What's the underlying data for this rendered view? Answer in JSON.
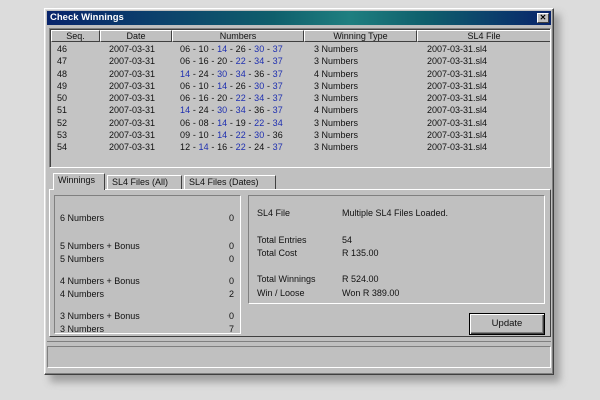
{
  "window": {
    "title": "Check Winnings",
    "close_label": "✕"
  },
  "list": {
    "headers": [
      "Seq.",
      "Date",
      "Numbers",
      "Winning Type",
      "SL4 File"
    ],
    "rows": [
      {
        "seq": "46",
        "date": "2007-03-31",
        "numbers": [
          [
            "06",
            "miss"
          ],
          [
            "10",
            "miss"
          ],
          [
            "14",
            "hit"
          ],
          [
            "26",
            "miss"
          ],
          [
            "30",
            "hit"
          ],
          [
            "37",
            "hit"
          ]
        ],
        "type": "3 Numbers",
        "file": "2007-03-31.sl4"
      },
      {
        "seq": "47",
        "date": "2007-03-31",
        "numbers": [
          [
            "06",
            "miss"
          ],
          [
            "16",
            "miss"
          ],
          [
            "20",
            "miss"
          ],
          [
            "22",
            "hit"
          ],
          [
            "34",
            "hit"
          ],
          [
            "37",
            "hit"
          ]
        ],
        "type": "3 Numbers",
        "file": "2007-03-31.sl4"
      },
      {
        "seq": "48",
        "date": "2007-03-31",
        "numbers": [
          [
            "14",
            "hit"
          ],
          [
            "24",
            "miss"
          ],
          [
            "30",
            "hit"
          ],
          [
            "34",
            "hit"
          ],
          [
            "36",
            "miss"
          ],
          [
            "37",
            "hit"
          ]
        ],
        "type": "4 Numbers",
        "file": "2007-03-31.sl4"
      },
      {
        "seq": "49",
        "date": "2007-03-31",
        "numbers": [
          [
            "06",
            "miss"
          ],
          [
            "10",
            "miss"
          ],
          [
            "14",
            "hit"
          ],
          [
            "26",
            "miss"
          ],
          [
            "30",
            "hit"
          ],
          [
            "37",
            "hit"
          ]
        ],
        "type": "3 Numbers",
        "file": "2007-03-31.sl4"
      },
      {
        "seq": "50",
        "date": "2007-03-31",
        "numbers": [
          [
            "06",
            "miss"
          ],
          [
            "16",
            "miss"
          ],
          [
            "20",
            "miss"
          ],
          [
            "22",
            "hit"
          ],
          [
            "34",
            "hit"
          ],
          [
            "37",
            "hit"
          ]
        ],
        "type": "3 Numbers",
        "file": "2007-03-31.sl4"
      },
      {
        "seq": "51",
        "date": "2007-03-31",
        "numbers": [
          [
            "14",
            "hit"
          ],
          [
            "24",
            "miss"
          ],
          [
            "30",
            "hit"
          ],
          [
            "34",
            "hit"
          ],
          [
            "36",
            "miss"
          ],
          [
            "37",
            "hit"
          ]
        ],
        "type": "4 Numbers",
        "file": "2007-03-31.sl4"
      },
      {
        "seq": "52",
        "date": "2007-03-31",
        "numbers": [
          [
            "06",
            "miss"
          ],
          [
            "08",
            "miss"
          ],
          [
            "14",
            "hit"
          ],
          [
            "19",
            "miss"
          ],
          [
            "22",
            "hit"
          ],
          [
            "34",
            "hit"
          ]
        ],
        "type": "3 Numbers",
        "file": "2007-03-31.sl4"
      },
      {
        "seq": "53",
        "date": "2007-03-31",
        "numbers": [
          [
            "09",
            "miss"
          ],
          [
            "10",
            "miss"
          ],
          [
            "14",
            "hit"
          ],
          [
            "22",
            "hit"
          ],
          [
            "30",
            "hit"
          ],
          [
            "36",
            "miss"
          ]
        ],
        "type": "3 Numbers",
        "file": "2007-03-31.sl4"
      },
      {
        "seq": "54",
        "date": "2007-03-31",
        "numbers": [
          [
            "12",
            "miss"
          ],
          [
            "14",
            "hit"
          ],
          [
            "16",
            "miss"
          ],
          [
            "22",
            "hit"
          ],
          [
            "24",
            "miss"
          ],
          [
            "37",
            "hit"
          ]
        ],
        "type": "3 Numbers",
        "file": "2007-03-31.sl4"
      }
    ]
  },
  "tabs": [
    "Winnings",
    "SL4 Files (All)",
    "SL4 Files (Dates)"
  ],
  "winnings": [
    {
      "label": "6 Numbers",
      "value": "0"
    },
    {
      "label": "5 Numbers + Bonus",
      "value": "0"
    },
    {
      "label": "5 Numbers",
      "value": "0"
    },
    {
      "label": "4 Numbers + Bonus",
      "value": "0"
    },
    {
      "label": "4 Numbers",
      "value": "2"
    },
    {
      "label": "3 Numbers + Bonus",
      "value": "0"
    },
    {
      "label": "3 Numbers",
      "value": "7"
    }
  ],
  "summary": {
    "sl4_file_label": "SL4 File",
    "sl4_file_value": "Multiple SL4 Files Loaded.",
    "total_entries_label": "Total Entries",
    "total_entries_value": "54",
    "total_cost_label": "Total Cost",
    "total_cost_value": "R 135.00",
    "total_winnings_label": "Total Winnings",
    "total_winnings_value": "R 524.00",
    "win_loose_label": "Win / Loose",
    "win_loose_value": "Won R 389.00"
  },
  "update_label": "Update",
  "colors": {
    "hit_number": "#1e2fb0",
    "title_bar": "#08246b"
  }
}
